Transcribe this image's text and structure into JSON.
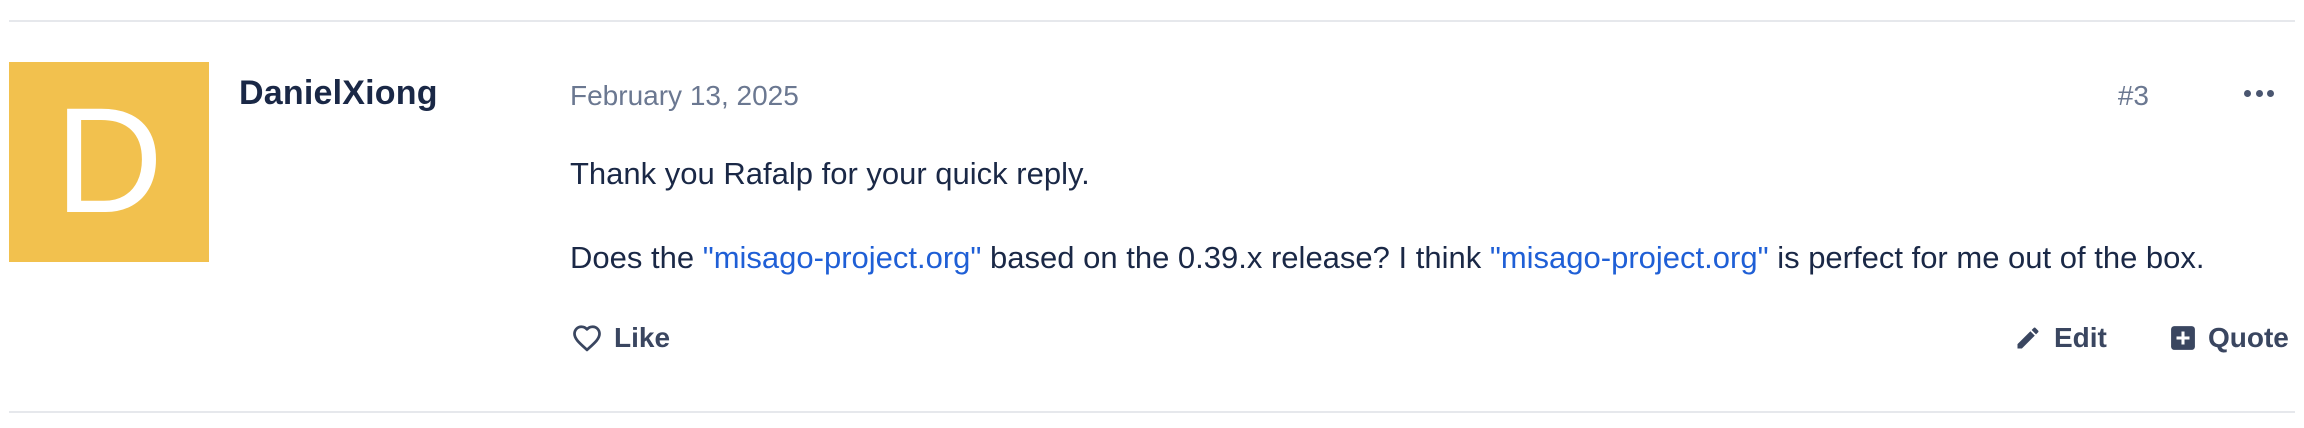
{
  "post": {
    "author": "DanielXiong",
    "avatar_letter": "D",
    "avatar_color": "#f2c14e",
    "date": "February 13, 2025",
    "number": "#3",
    "body": {
      "paragraph1": "Thank you Rafalp for your quick reply.",
      "paragraph2": {
        "part1": "Does the ",
        "link1": "\"misago-project.org\"",
        "part2": " based on the 0.39.x release? I think ",
        "link2": "\"misago-project.org\"",
        "part3": " is perfect for me out of the box."
      }
    },
    "actions": {
      "like_label": "Like",
      "edit_label": "Edit",
      "quote_label": "Quote"
    },
    "icons": {
      "like": "heart-outline-icon",
      "edit": "pencil-icon",
      "quote": "plus-square-icon",
      "more": "ellipsis-icon"
    },
    "colors": {
      "link": "#1f5fd6",
      "text": "#1a2846",
      "muted": "#6b7891"
    }
  }
}
